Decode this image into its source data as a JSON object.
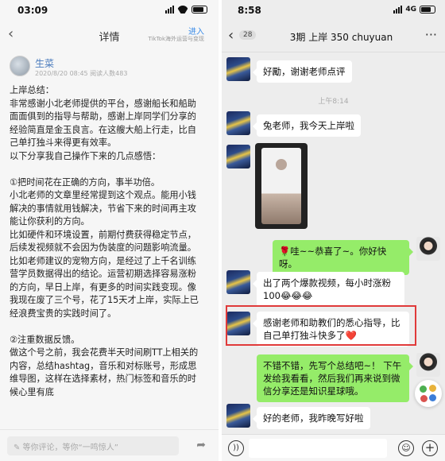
{
  "left": {
    "status_time": "03:09",
    "nav": {
      "back": "‹",
      "title": "详情",
      "join": "进入",
      "join_sub": "TikTok海外运营与变现"
    },
    "author": {
      "name": "生菜",
      "meta": "2020/8/20 08:45  阅读人数483"
    },
    "article_lines": [
      "上岸总结：",
      "非常感谢小北老师提供的平台，感谢船长和船助",
      "面面俱到的指导与帮助，感谢上岸同学们分享的",
      "经验简直是金玉良言。在这艘大船上行走，比自",
      "己单打独斗来得更有效率。",
      "以下分享我自己操作下来的几点感悟：",
      "",
      "①把时间花在正确的方向，事半功倍。",
      "小北老师的文章里经常提到这个观点。能用小钱",
      "解决的事情就用钱解决，节省下来的时间再主攻",
      "能让你获利的方向。",
      "比如硬件和环境设置，前期付费获得稳定节点，",
      "后续发视频就不会因为伪装度的问题影响流量。",
      "比如老师建议的宠物方向，是经过了上千名训练",
      "营学员数据得出的结论。运营初期选择容易涨粉",
      "的方向，早日上岸，有更多的时间实践变现。像",
      "我现在废了三个号，花了15天才上岸，实际上已",
      "经浪费宝贵的实践时间了。",
      "",
      "②注重数据反馈。",
      "做这个号之前，我会花费半天时间刷TT上相关的",
      "内容，总结hashtag，音乐和对标账号，形成思",
      "维导图，这样在选择素材，热门标签和音乐的时",
      "候心里有底"
    ],
    "comment_placeholder": "✎ 等你评论，等你“一鸣惊人”",
    "share_icon": "share-icon"
  },
  "right": {
    "status_time": "8:58",
    "network": "4G",
    "nav": {
      "back": "‹",
      "unread": "28",
      "title": "3期 上岸 350 chuyuan",
      "more": "···"
    },
    "timestamp": "上午8:14",
    "messages": [
      {
        "text": "好勵，谢谢老师点评"
      },
      {
        "text": "兔老师，我今天上岸啦"
      },
      {
        "text": "🌹哇~~恭喜了~。你好快呀。"
      },
      {
        "line1": "出了两个爆款视频，每小时涨粉",
        "line2": "100😂😂😂"
      },
      {
        "line1": "感谢老师和助教们的悉心指导，比",
        "line2": "自己单打独斗快多了❤️"
      },
      {
        "line1": "不错不错，先写个总结吧~！ 下午",
        "line2": "发给我看看，然后我们再来说到微",
        "line3": "信分享还是知识星球哦。"
      },
      {
        "text": "好的老师，我昨晚写好啦"
      }
    ],
    "highlight_color": "#e03a3a",
    "bubble_green": "#95ec69"
  }
}
